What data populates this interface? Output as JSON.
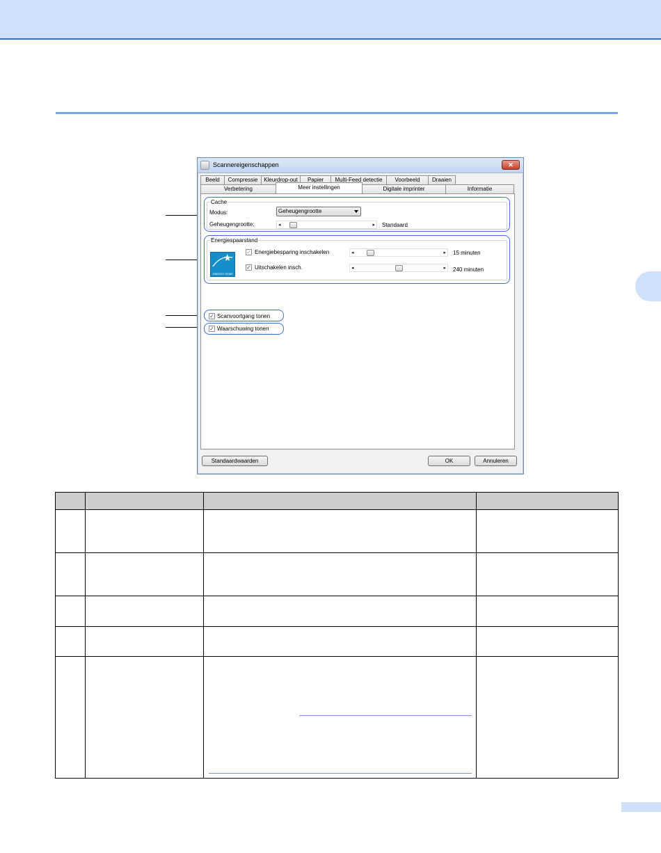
{
  "dialog": {
    "title": "Scannereigenschappen",
    "close_glyph": "✕",
    "tabs_row1": [
      "Beeld",
      "Compressie",
      "Kleurdrop-out",
      "Papier",
      "Multi-Feed detectie",
      "Voorbeeld",
      "Draaien"
    ],
    "tabs_row2": [
      "Verbetering",
      "Meer instellingen",
      "Digitale imprinter",
      "Informatie"
    ],
    "active_tab": "Meer instellingen",
    "cache": {
      "legend": "Cache",
      "modus_label": "Modus:",
      "modus_value": "Geheugengrootte",
      "size_label": "Geheugengrootte:",
      "size_value": "Standaard",
      "size_level": 0.06
    },
    "energy": {
      "legend": "Energiespaarstand",
      "logo_text": "ENERGY STAR",
      "save_label": "Energiebesparing inschakelen",
      "save_checked": true,
      "save_value": "15 minuten",
      "save_level": 0.11,
      "off_label": "Uitschakelen insch.",
      "off_checked": true,
      "off_value": "240 minuten",
      "off_level": 0.5
    },
    "show_progress_label": "Scanvoortgang tonen",
    "show_progress_checked": true,
    "show_warning_label": "Waarschuwing tonen",
    "show_warning_checked": true,
    "defaults_button": "Standaardwaarden",
    "ok_button": "OK",
    "cancel_button": "Annuleren",
    "check_glyph": "✓",
    "arrow_left": "◂",
    "arrow_right": "▸"
  },
  "colors": {
    "band": "#cfe0fb",
    "accent": "#3a6fd8",
    "energy_star": "#168ec8"
  }
}
